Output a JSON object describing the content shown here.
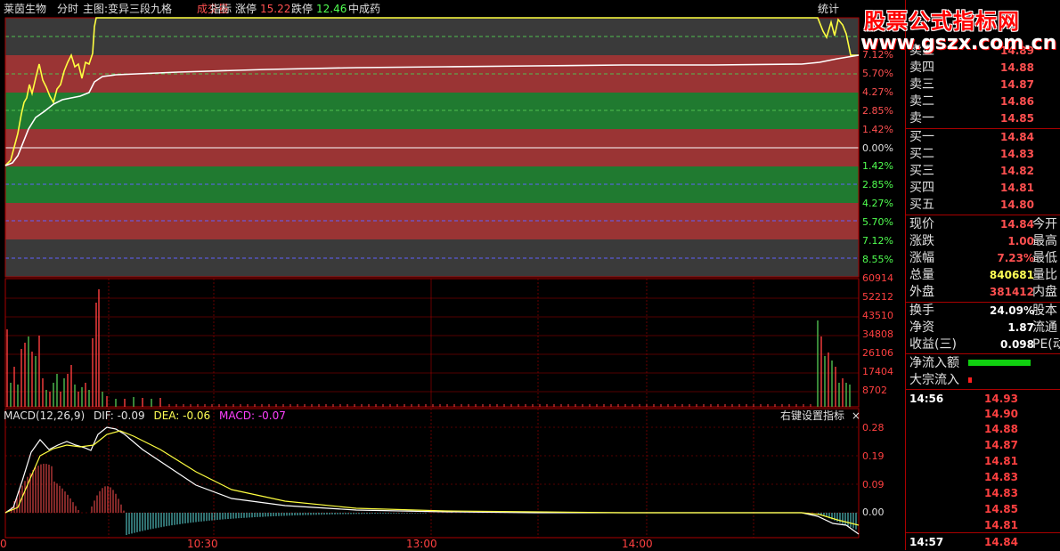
{
  "header": {
    "stock_name": "莱茵生物",
    "mode": "分时",
    "main_chart": "主图:变异三段九格",
    "volume_label": "成交量",
    "indicator_label": "指标",
    "limit_up_label": "涨停",
    "limit_up_value": "15.22",
    "limit_down_label": "跌停",
    "limit_down_value": "12.46",
    "sector": "中成药",
    "stats_label": "统计"
  },
  "watermark": {
    "title": "股票公式指标网",
    "url": "www.gszx.com.cn"
  },
  "price_axis": {
    "up": [
      "7.12%",
      "5.70%",
      "4.27%",
      "2.85%",
      "1.42%"
    ],
    "zero": "0.00%",
    "down": [
      "1.42%",
      "2.85%",
      "4.27%",
      "5.70%",
      "7.12%",
      "8.55%"
    ]
  },
  "volume_axis": [
    "60914",
    "52212",
    "43510",
    "34808",
    "26106",
    "17404",
    "8702"
  ],
  "macd": {
    "title": "MACD(12,26,9)",
    "dif": "DIF: -0.09",
    "dea": "DEA: -0.06",
    "macd": "MACD: -0.07",
    "right_click": "右键设置指标",
    "close": "×",
    "axis": [
      "0.28",
      "0.19",
      "0.09",
      "0.00"
    ]
  },
  "time_axis": [
    "0",
    "10:30",
    "13:00",
    "14:00"
  ],
  "order_book": {
    "sell": [
      {
        "label": "卖五",
        "price": "14.89"
      },
      {
        "label": "卖四",
        "price": "14.88"
      },
      {
        "label": "卖三",
        "price": "14.87"
      },
      {
        "label": "卖二",
        "price": "14.86"
      },
      {
        "label": "卖一",
        "price": "14.85"
      }
    ],
    "buy": [
      {
        "label": "买一",
        "price": "14.84"
      },
      {
        "label": "买二",
        "price": "14.83"
      },
      {
        "label": "买三",
        "price": "14.82"
      },
      {
        "label": "买四",
        "price": "14.81"
      },
      {
        "label": "买五",
        "price": "14.80"
      }
    ]
  },
  "quote": {
    "current_label": "现价",
    "current": "14.84",
    "open_label": "今开",
    "change_label": "涨跌",
    "change": "1.00",
    "high_label": "最高",
    "pct_label": "涨幅",
    "pct": "7.23%",
    "low_label": "最低",
    "volume_label": "总量",
    "volume": "840681",
    "ratio_label": "量比",
    "outer_label": "外盘",
    "outer": "381412",
    "inner_label": "内盘",
    "turnover_label": "换手",
    "turnover": "24.09%",
    "equity_label": "股本",
    "nav_label": "净资",
    "nav": "1.87",
    "float_label": "流通",
    "eps_label": "收益(三)",
    "eps": "0.098",
    "pe_label": "PE(动)"
  },
  "flow": {
    "net_inflow_label": "净流入额",
    "block_inflow_label": "大宗流入"
  },
  "ticks": {
    "time_a": "14:56",
    "prices": [
      "14.93",
      "14.90",
      "14.88",
      "14.87",
      "14.81",
      "14.83",
      "14.83",
      "14.85",
      "14.81"
    ],
    "time_b": "14:57",
    "last_price": "14.84"
  },
  "colors": {
    "red_band": "#9a3434",
    "green_band": "#207a30",
    "gray_band": "#3a3a3a",
    "price_line": "#ffff40",
    "avg_line": "#ffffff",
    "grid_red": "#aa0000"
  }
}
